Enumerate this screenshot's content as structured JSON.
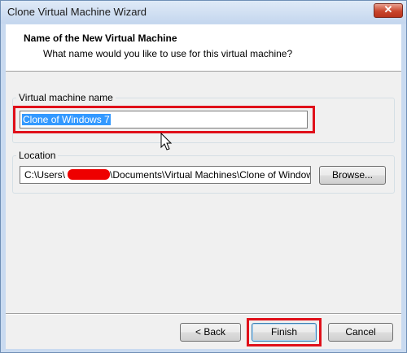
{
  "window": {
    "title": "Clone Virtual Machine Wizard"
  },
  "titlebar": {
    "close_glyph": "✕"
  },
  "header": {
    "title": "Name of the New Virtual Machine",
    "subtitle": "What name would you like to use for this virtual machine?"
  },
  "vm_name": {
    "label": "Virtual machine name",
    "value": "Clone of Windows 7"
  },
  "location": {
    "label": "Location",
    "value_prefix": "C:\\Users\\",
    "value_suffix": "\\Documents\\Virtual Machines\\Clone of Window",
    "browse_label": "Browse..."
  },
  "footer": {
    "back_label": "< Back",
    "finish_label": "Finish",
    "cancel_label": "Cancel"
  },
  "colors": {
    "annotation": "#e0101a",
    "selection": "#3399ff"
  }
}
